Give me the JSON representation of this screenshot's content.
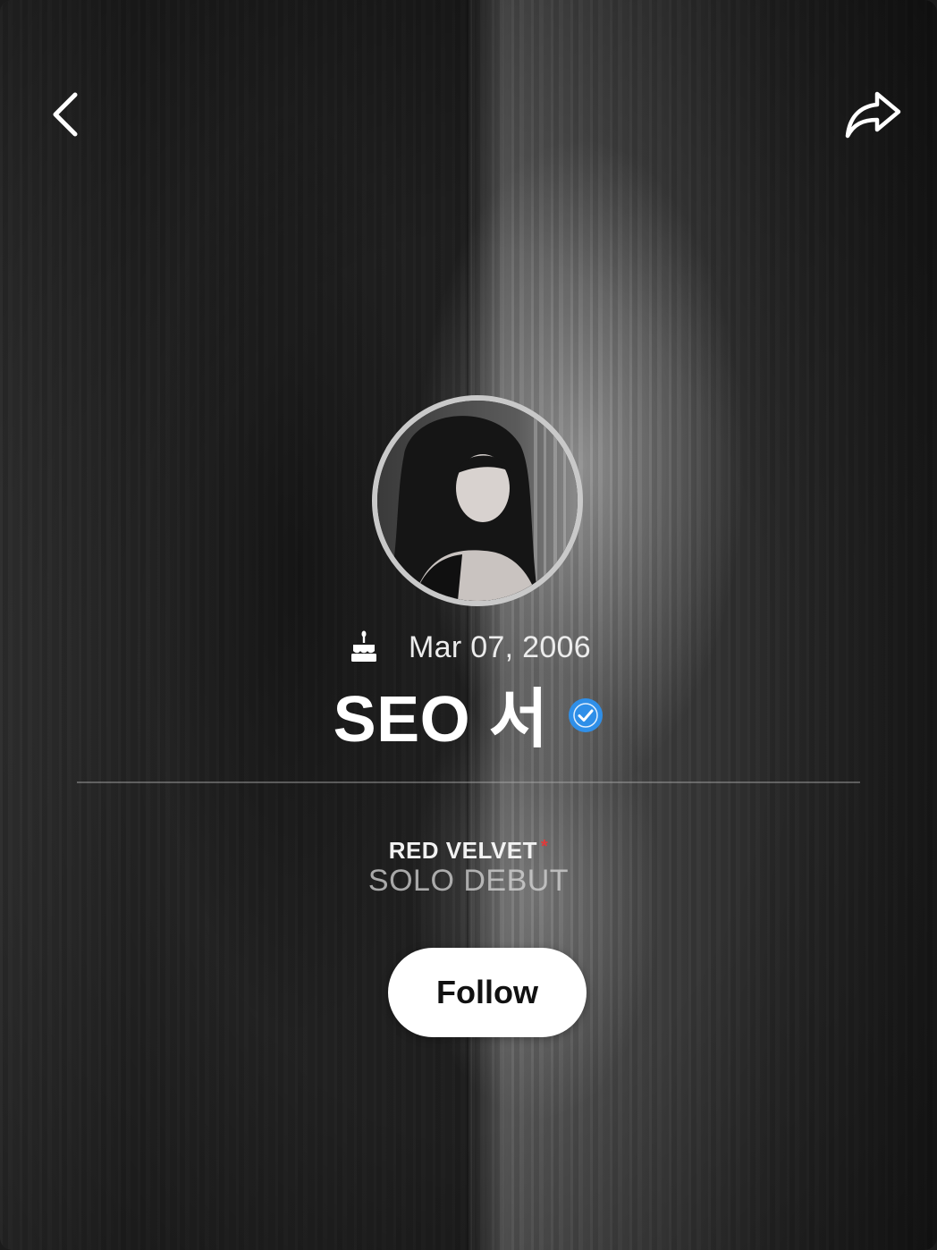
{
  "profile": {
    "birthday": "Mar 07, 2006",
    "name": "SEO 서",
    "verified": true,
    "group": "RED VELVET",
    "group_marker": "*",
    "subtitle": "SOLO DEBUT"
  },
  "actions": {
    "follow_label": "Follow"
  },
  "icons": {
    "back": "chevron-left-icon",
    "share": "share-arrow-icon",
    "birthday": "birthday-cake-icon",
    "verified": "verified-badge-icon"
  },
  "colors": {
    "verified_badge": "#2f8fe8",
    "group_marker": "#e03a3a",
    "follow_button_bg": "#ffffff",
    "follow_button_text": "#111111"
  }
}
